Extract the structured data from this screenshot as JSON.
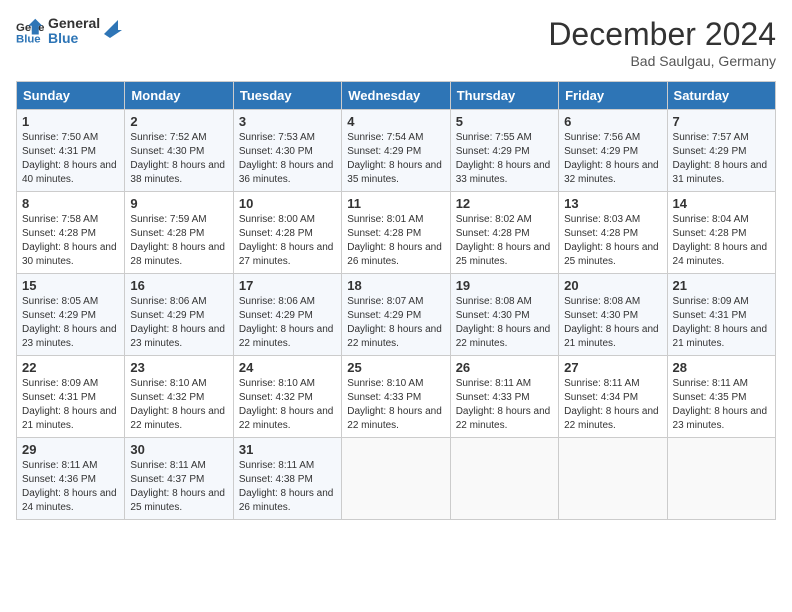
{
  "header": {
    "logo_line1": "General",
    "logo_line2": "Blue",
    "month": "December 2024",
    "location": "Bad Saulgau, Germany"
  },
  "weekdays": [
    "Sunday",
    "Monday",
    "Tuesday",
    "Wednesday",
    "Thursday",
    "Friday",
    "Saturday"
  ],
  "weeks": [
    [
      {
        "day": "1",
        "sunrise": "Sunrise: 7:50 AM",
        "sunset": "Sunset: 4:31 PM",
        "daylight": "Daylight: 8 hours and 40 minutes."
      },
      {
        "day": "2",
        "sunrise": "Sunrise: 7:52 AM",
        "sunset": "Sunset: 4:30 PM",
        "daylight": "Daylight: 8 hours and 38 minutes."
      },
      {
        "day": "3",
        "sunrise": "Sunrise: 7:53 AM",
        "sunset": "Sunset: 4:30 PM",
        "daylight": "Daylight: 8 hours and 36 minutes."
      },
      {
        "day": "4",
        "sunrise": "Sunrise: 7:54 AM",
        "sunset": "Sunset: 4:29 PM",
        "daylight": "Daylight: 8 hours and 35 minutes."
      },
      {
        "day": "5",
        "sunrise": "Sunrise: 7:55 AM",
        "sunset": "Sunset: 4:29 PM",
        "daylight": "Daylight: 8 hours and 33 minutes."
      },
      {
        "day": "6",
        "sunrise": "Sunrise: 7:56 AM",
        "sunset": "Sunset: 4:29 PM",
        "daylight": "Daylight: 8 hours and 32 minutes."
      },
      {
        "day": "7",
        "sunrise": "Sunrise: 7:57 AM",
        "sunset": "Sunset: 4:29 PM",
        "daylight": "Daylight: 8 hours and 31 minutes."
      }
    ],
    [
      {
        "day": "8",
        "sunrise": "Sunrise: 7:58 AM",
        "sunset": "Sunset: 4:28 PM",
        "daylight": "Daylight: 8 hours and 30 minutes."
      },
      {
        "day": "9",
        "sunrise": "Sunrise: 7:59 AM",
        "sunset": "Sunset: 4:28 PM",
        "daylight": "Daylight: 8 hours and 28 minutes."
      },
      {
        "day": "10",
        "sunrise": "Sunrise: 8:00 AM",
        "sunset": "Sunset: 4:28 PM",
        "daylight": "Daylight: 8 hours and 27 minutes."
      },
      {
        "day": "11",
        "sunrise": "Sunrise: 8:01 AM",
        "sunset": "Sunset: 4:28 PM",
        "daylight": "Daylight: 8 hours and 26 minutes."
      },
      {
        "day": "12",
        "sunrise": "Sunrise: 8:02 AM",
        "sunset": "Sunset: 4:28 PM",
        "daylight": "Daylight: 8 hours and 25 minutes."
      },
      {
        "day": "13",
        "sunrise": "Sunrise: 8:03 AM",
        "sunset": "Sunset: 4:28 PM",
        "daylight": "Daylight: 8 hours and 25 minutes."
      },
      {
        "day": "14",
        "sunrise": "Sunrise: 8:04 AM",
        "sunset": "Sunset: 4:28 PM",
        "daylight": "Daylight: 8 hours and 24 minutes."
      }
    ],
    [
      {
        "day": "15",
        "sunrise": "Sunrise: 8:05 AM",
        "sunset": "Sunset: 4:29 PM",
        "daylight": "Daylight: 8 hours and 23 minutes."
      },
      {
        "day": "16",
        "sunrise": "Sunrise: 8:06 AM",
        "sunset": "Sunset: 4:29 PM",
        "daylight": "Daylight: 8 hours and 23 minutes."
      },
      {
        "day": "17",
        "sunrise": "Sunrise: 8:06 AM",
        "sunset": "Sunset: 4:29 PM",
        "daylight": "Daylight: 8 hours and 22 minutes."
      },
      {
        "day": "18",
        "sunrise": "Sunrise: 8:07 AM",
        "sunset": "Sunset: 4:29 PM",
        "daylight": "Daylight: 8 hours and 22 minutes."
      },
      {
        "day": "19",
        "sunrise": "Sunrise: 8:08 AM",
        "sunset": "Sunset: 4:30 PM",
        "daylight": "Daylight: 8 hours and 22 minutes."
      },
      {
        "day": "20",
        "sunrise": "Sunrise: 8:08 AM",
        "sunset": "Sunset: 4:30 PM",
        "daylight": "Daylight: 8 hours and 21 minutes."
      },
      {
        "day": "21",
        "sunrise": "Sunrise: 8:09 AM",
        "sunset": "Sunset: 4:31 PM",
        "daylight": "Daylight: 8 hours and 21 minutes."
      }
    ],
    [
      {
        "day": "22",
        "sunrise": "Sunrise: 8:09 AM",
        "sunset": "Sunset: 4:31 PM",
        "daylight": "Daylight: 8 hours and 21 minutes."
      },
      {
        "day": "23",
        "sunrise": "Sunrise: 8:10 AM",
        "sunset": "Sunset: 4:32 PM",
        "daylight": "Daylight: 8 hours and 22 minutes."
      },
      {
        "day": "24",
        "sunrise": "Sunrise: 8:10 AM",
        "sunset": "Sunset: 4:32 PM",
        "daylight": "Daylight: 8 hours and 22 minutes."
      },
      {
        "day": "25",
        "sunrise": "Sunrise: 8:10 AM",
        "sunset": "Sunset: 4:33 PM",
        "daylight": "Daylight: 8 hours and 22 minutes."
      },
      {
        "day": "26",
        "sunrise": "Sunrise: 8:11 AM",
        "sunset": "Sunset: 4:33 PM",
        "daylight": "Daylight: 8 hours and 22 minutes."
      },
      {
        "day": "27",
        "sunrise": "Sunrise: 8:11 AM",
        "sunset": "Sunset: 4:34 PM",
        "daylight": "Daylight: 8 hours and 22 minutes."
      },
      {
        "day": "28",
        "sunrise": "Sunrise: 8:11 AM",
        "sunset": "Sunset: 4:35 PM",
        "daylight": "Daylight: 8 hours and 23 minutes."
      }
    ],
    [
      {
        "day": "29",
        "sunrise": "Sunrise: 8:11 AM",
        "sunset": "Sunset: 4:36 PM",
        "daylight": "Daylight: 8 hours and 24 minutes."
      },
      {
        "day": "30",
        "sunrise": "Sunrise: 8:11 AM",
        "sunset": "Sunset: 4:37 PM",
        "daylight": "Daylight: 8 hours and 25 minutes."
      },
      {
        "day": "31",
        "sunrise": "Sunrise: 8:11 AM",
        "sunset": "Sunset: 4:38 PM",
        "daylight": "Daylight: 8 hours and 26 minutes."
      },
      null,
      null,
      null,
      null
    ]
  ]
}
